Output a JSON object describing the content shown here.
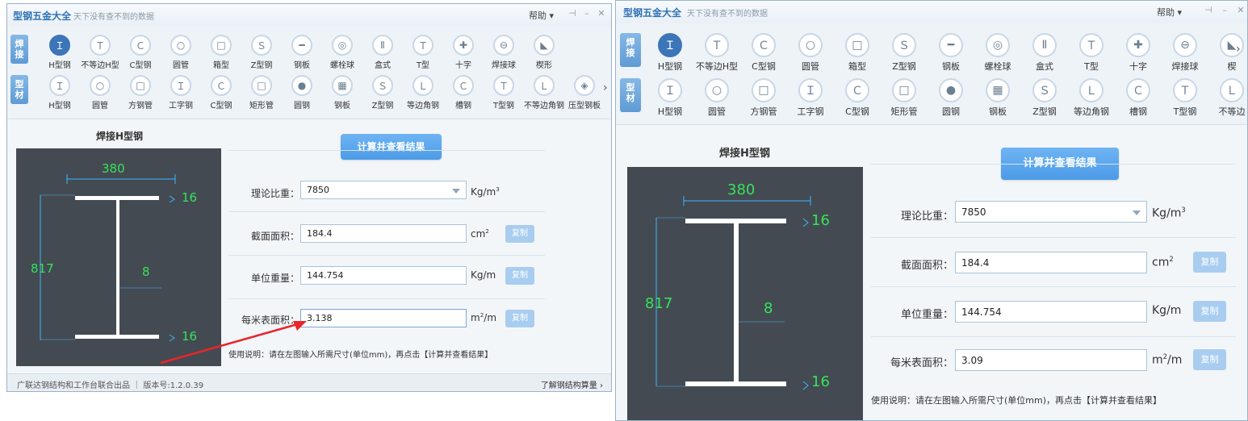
{
  "app": {
    "title": "型钢五金大全",
    "slogan": "天下没有查不到的数据",
    "help": "帮助"
  },
  "categories": {
    "weld": "焊\n接",
    "profile": "型\n材"
  },
  "weld_items": [
    "H型钢",
    "不等边H型",
    "C型钢",
    "圆管",
    "箱型",
    "Z型钢",
    "钢板",
    "螺栓球",
    "盒式",
    "T型",
    "十字",
    "焊接球",
    "楔形"
  ],
  "profile_items": [
    "H型钢",
    "圆管",
    "方钢管",
    "工字钢",
    "C型钢",
    "矩形管",
    "圆钢",
    "钢板",
    "Z型钢",
    "等边角钢",
    "槽钢",
    "T型钢",
    "不等边角钢",
    "压型钢板"
  ],
  "winB_weld_items": [
    "H型钢",
    "不等边H型",
    "C型钢",
    "圆管",
    "箱型",
    "Z型钢",
    "钢板",
    "螺栓球",
    "盒式",
    "T型",
    "十字",
    "焊接球",
    "楔"
  ],
  "winB_profile_items": [
    "H型钢",
    "圆管",
    "方钢管",
    "工字钢",
    "C型钢",
    "矩形管",
    "圆钢",
    "钢板",
    "Z型钢",
    "等边角钢",
    "槽钢",
    "T型钢",
    "不等边"
  ],
  "drawing": {
    "title": "焊接H型钢",
    "width": "380",
    "flange_top": "16",
    "height": "817",
    "web": "8",
    "flange_bottom": "16"
  },
  "calc_button": "计算并查看结果",
  "fields": {
    "density_label": "理论比重：",
    "density_value": "7850",
    "density_unit": "Kg/m",
    "area_label": "截面面积：",
    "area_value": "184.4",
    "area_unit": "cm",
    "weight_label": "单位重量：",
    "weight_value": "144.754",
    "weight_unit": "Kg/m",
    "surface_label": "每米表面积：",
    "surface_unit": "m",
    "surface_unit_tail": "/m",
    "copy": "复制"
  },
  "winA_surface_value": "3.138",
  "winB_surface_value": "3.09",
  "hint": "使用说明：请在左图输入所需尺寸(单位mm)，再点击【计算并查看结果】",
  "status": {
    "left": "广联达钢结构和工作台联合出品 ｜ 版本号:1.2.0.39",
    "right": "了解钢结构算量"
  },
  "colors": {
    "accent": "#4b9be8",
    "dim_green": "#35e35a",
    "canvas": "#444a52",
    "arrow": "#e8252a"
  }
}
